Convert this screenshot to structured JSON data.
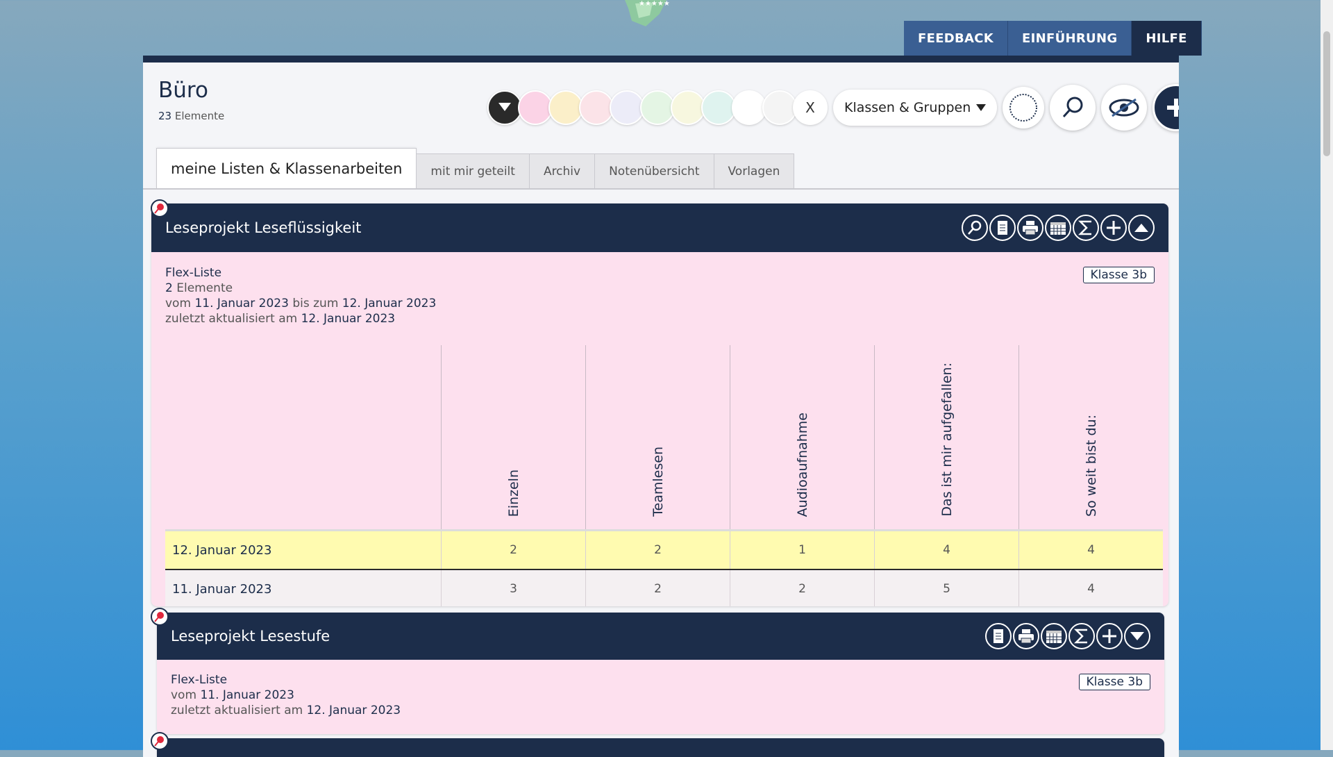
{
  "top_nav": {
    "feedback": "FEEDBACK",
    "einfuehrung": "EINFÜHRUNG",
    "hilfe": "HILFE"
  },
  "header": {
    "title": "Büro",
    "count": "23",
    "count_label": "Elemente"
  },
  "filter": {
    "clear": "X",
    "group_select": "Klassen & Gruppen",
    "colors": [
      "#fbd3e6",
      "#fbefc9",
      "#fbe3e8",
      "#ececf8",
      "#e4f5e4",
      "#f7f7df",
      "#dff3ef",
      "#ffffff",
      "#f4f4f4"
    ]
  },
  "tabs": [
    "meine Listen & Klassenarbeiten",
    "mit mir geteilt",
    "Archiv",
    "Notenübersicht",
    "Vorlagen"
  ],
  "card1": {
    "title": "Leseprojekt Leseflüssigkeit",
    "type": "Flex-Liste",
    "count": "2",
    "count_label": "Elemente",
    "from_prefix": "vom",
    "from": "11. Januar 2023",
    "to_prefix": "bis zum",
    "to": "12. Januar 2023",
    "updated_prefix": "zuletzt aktualisiert am",
    "updated": "12. Januar 2023",
    "badge": "Klasse 3b",
    "columns": [
      "Einzeln",
      "Teamlesen",
      "Audioaufnahme",
      "Das ist mir aufgefallen:",
      "So weit bist du:"
    ],
    "rows": [
      {
        "date": "12. Januar 2023",
        "values": [
          "2",
          "2",
          "1",
          "4",
          "4"
        ]
      },
      {
        "date": "11. Januar 2023",
        "values": [
          "3",
          "2",
          "2",
          "5",
          "4"
        ]
      }
    ]
  },
  "card2": {
    "title": "Leseprojekt Lesestufe",
    "type": "Flex-Liste",
    "from_prefix": "vom",
    "from": "11. Januar 2023",
    "updated_prefix": "zuletzt aktualisiert am",
    "updated": "12. Januar 2023",
    "badge": "Klasse 3b"
  }
}
